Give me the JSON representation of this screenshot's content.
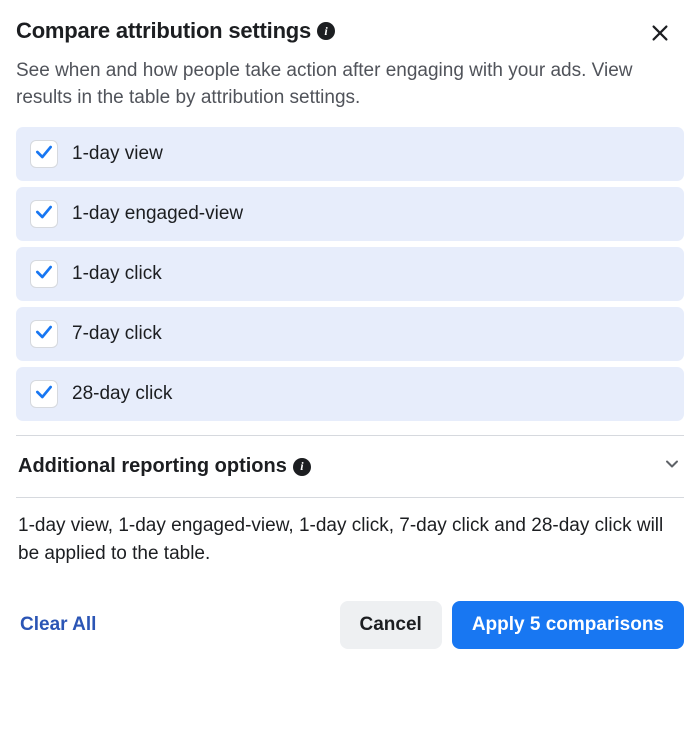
{
  "header": {
    "title": "Compare attribution settings",
    "subtitle": "See when and how people take action after engaging with your ads. View results in the table by attribution settings."
  },
  "options": [
    {
      "label": "1-day view",
      "checked": true
    },
    {
      "label": "1-day engaged-view",
      "checked": true
    },
    {
      "label": "1-day click",
      "checked": true
    },
    {
      "label": "7-day click",
      "checked": true
    },
    {
      "label": "28-day click",
      "checked": true
    }
  ],
  "additional": {
    "title": "Additional reporting options"
  },
  "summary": "1-day view, 1-day engaged-view, 1-day click, 7-day click and 28-day click will be applied to the table.",
  "footer": {
    "clear": "Clear All",
    "cancel": "Cancel",
    "apply": "Apply 5 comparisons"
  }
}
